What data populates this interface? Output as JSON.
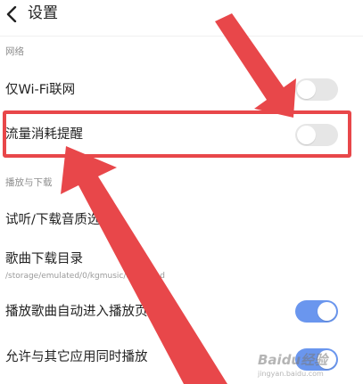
{
  "header": {
    "title": "设置",
    "back_icon": "chevron-left-icon"
  },
  "sections": {
    "network": {
      "label": "网络"
    },
    "playback": {
      "label": "播放与下载"
    }
  },
  "rows": {
    "wifi_only": {
      "title": "仅Wi-Fi联网",
      "toggle": "off"
    },
    "data_reminder": {
      "title": "流量消耗提醒",
      "toggle": "off"
    },
    "quality": {
      "title": "试听/下载音质选择"
    },
    "download_dir": {
      "title": "歌曲下载目录",
      "path": "/storage/emulated/0/kgmusic/download"
    },
    "auto_play_page": {
      "title": "播放歌曲自动进入播放页",
      "toggle": "on"
    },
    "mix_play": {
      "title": "允许与其它应用同时播放",
      "toggle": "on"
    }
  },
  "watermark": {
    "logo": "Baidu经验",
    "site": "jingyan.baidu.com"
  },
  "colors": {
    "annotation_red": "#e8474a",
    "toggle_on": "#6a96ee",
    "toggle_off": "#e6e6e6"
  }
}
